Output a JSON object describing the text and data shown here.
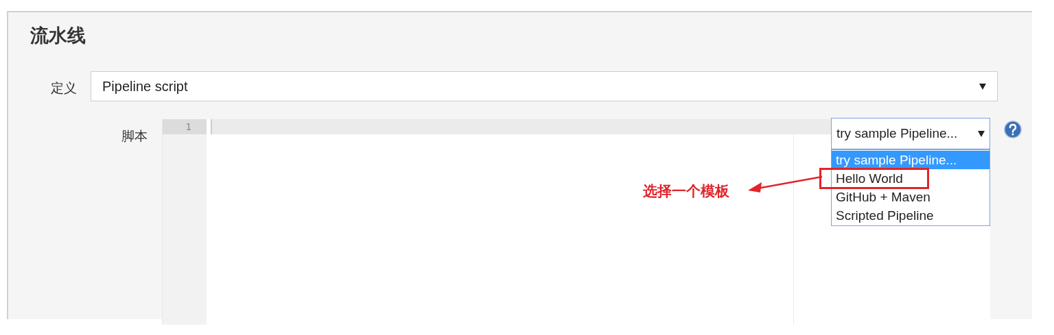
{
  "section": {
    "title": "流水线"
  },
  "definition": {
    "label": "定义",
    "value": "Pipeline script"
  },
  "script": {
    "label": "脚本",
    "line_numbers": [
      "1"
    ],
    "sample_select": {
      "value": "try sample Pipeline...",
      "open": true,
      "options": [
        {
          "label": "try sample Pipeline...",
          "selected": true,
          "highlighted": false
        },
        {
          "label": "Hello World",
          "selected": false,
          "highlighted": true
        },
        {
          "label": "GitHub + Maven",
          "selected": false,
          "highlighted": false
        },
        {
          "label": "Scripted Pipeline",
          "selected": false,
          "highlighted": false
        }
      ]
    }
  },
  "annotation": {
    "text": "选择一个模板"
  }
}
